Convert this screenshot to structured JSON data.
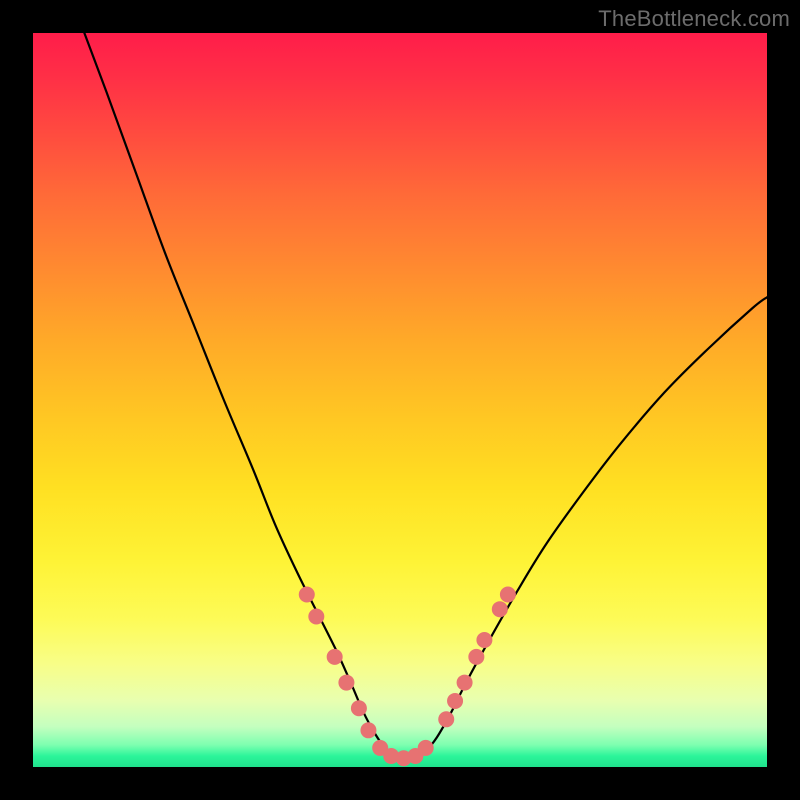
{
  "watermark": "TheBottleneck.com",
  "colors": {
    "curve_stroke": "#000000",
    "dot_fill": "#e77272",
    "dot_stroke": "#c25858",
    "frame_bg": "#000000"
  },
  "chart_data": {
    "type": "line",
    "title": "",
    "xlabel": "",
    "ylabel": "",
    "xlim": [
      0,
      100
    ],
    "ylim": [
      0,
      100
    ],
    "grid": false,
    "note": "No numeric axis ticks or labels are visible; x/y are percent of plot area. y increases upward (0 at bottom green band, 100 at top red band).",
    "series": [
      {
        "name": "bottleneck-curve",
        "x": [
          7,
          10,
          14,
          18,
          22,
          26,
          30,
          33,
          36,
          39,
          41.5,
          43.5,
          45,
          46.5,
          48,
          50,
          52,
          53.5,
          55,
          57,
          59,
          62,
          66,
          70,
          75,
          80,
          86,
          92,
          98,
          100
        ],
        "y": [
          100,
          92,
          81,
          70,
          60,
          50,
          40.5,
          33,
          26.5,
          20.5,
          15.5,
          11,
          7.5,
          4.7,
          2.6,
          1.3,
          1.3,
          2.2,
          4.0,
          7.5,
          11.5,
          17,
          24,
          30.5,
          37.5,
          44,
          51,
          57,
          62.5,
          64
        ]
      }
    ],
    "dots": {
      "name": "highlight-dots",
      "points": [
        {
          "x": 37.3,
          "y": 23.5
        },
        {
          "x": 38.6,
          "y": 20.5
        },
        {
          "x": 41.1,
          "y": 15.0
        },
        {
          "x": 42.7,
          "y": 11.5
        },
        {
          "x": 44.4,
          "y": 8.0
        },
        {
          "x": 45.7,
          "y": 5.0
        },
        {
          "x": 47.3,
          "y": 2.6
        },
        {
          "x": 48.8,
          "y": 1.5
        },
        {
          "x": 50.5,
          "y": 1.2
        },
        {
          "x": 52.1,
          "y": 1.5
        },
        {
          "x": 53.5,
          "y": 2.6
        },
        {
          "x": 56.3,
          "y": 6.5
        },
        {
          "x": 57.5,
          "y": 9.0
        },
        {
          "x": 58.8,
          "y": 11.5
        },
        {
          "x": 60.4,
          "y": 15.0
        },
        {
          "x": 61.5,
          "y": 17.3
        },
        {
          "x": 63.6,
          "y": 21.5
        },
        {
          "x": 64.7,
          "y": 23.5
        }
      ]
    },
    "dot_radius_px": 8
  }
}
